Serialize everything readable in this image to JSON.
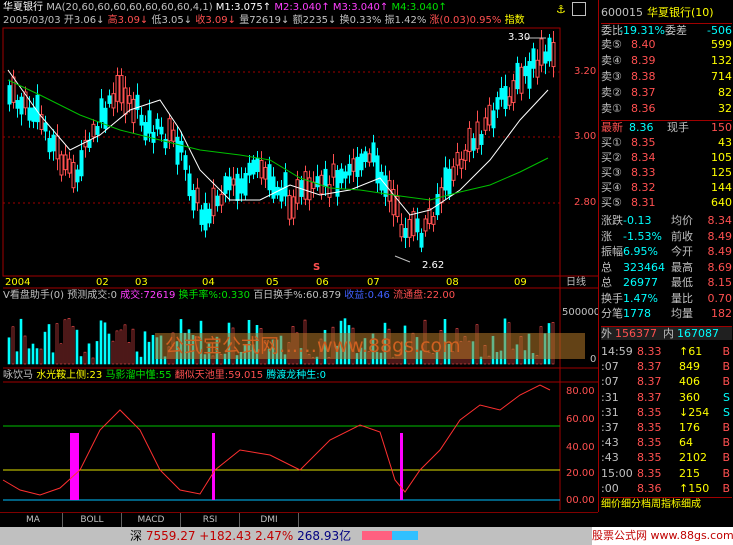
{
  "header": {
    "stock_name": "华夏银行",
    "ma_label": "MA(20,60,60,60,60,60,60,60,4,1)",
    "m1": "M1:3.075↑",
    "m2": "M2:3.040↑",
    "m3": "M3:3.040↑",
    "m4": "M4:3.040↑",
    "date": "2005/03/03",
    "open": "开3.06↓",
    "high": "高3.09↓",
    "low": "低3.05↓",
    "close": "收3.09↓",
    "volume": "量72619↓",
    "amount": "额2235↓",
    "turnover": "换0.33%",
    "amplitude": "振1.42%",
    "change": "涨(0.03)0.95%",
    "indicator": "指数"
  },
  "price_axis": [
    "3.20",
    "3.00",
    "2.80"
  ],
  "annotations": {
    "high_price": "3.30",
    "low_price": "2.62",
    "marker": "S"
  },
  "time_axis": [
    "2004",
    "02",
    "03",
    "04",
    "05",
    "06",
    "07",
    "08",
    "09"
  ],
  "period_label": "日线",
  "volume_panel": {
    "title": "V看盘助手(0)",
    "forecast": "预测成交:0",
    "deal": "成交:72619",
    "turnover_rate": "换手率%:0.330",
    "hundred_day": "百日换手%:60.879",
    "income": "收益:0.46",
    "float_shares": "流通盘:22.00",
    "axis": [
      "500000",
      "0"
    ]
  },
  "indicator_panel": {
    "name": "咏饮马",
    "s1": "水光鞍上侧:23",
    "s2": "马影溜中懂:55",
    "s3": "翻似天池里:59.015",
    "s4": "腾渡龙种生:0",
    "axis": [
      "80.00",
      "60.00",
      "40.00",
      "20.00",
      "00.00"
    ]
  },
  "watermark": "公式宝公式网……www.88gs.com",
  "tabs": [
    "MA",
    "BOLL",
    "MACD",
    "RSI",
    "DMI"
  ],
  "quote": {
    "code": "600015",
    "name": "华夏银行(10)",
    "weibi_label": "委比",
    "weibi": "-19.31%",
    "weicha_label": "委差",
    "weicha": "-506",
    "sells": [
      {
        "label": "卖⑤",
        "price": "8.40",
        "vol": "599"
      },
      {
        "label": "卖④",
        "price": "8.39",
        "vol": "132"
      },
      {
        "label": "卖③",
        "price": "8.38",
        "vol": "714"
      },
      {
        "label": "卖②",
        "price": "8.37",
        "vol": "82"
      },
      {
        "label": "卖①",
        "price": "8.36",
        "vol": "32"
      }
    ],
    "last_label": "最新",
    "last": "8.36",
    "now_label": "现手",
    "now": "150",
    "buys": [
      {
        "label": "买①",
        "price": "8.35",
        "vol": "43"
      },
      {
        "label": "买②",
        "price": "8.34",
        "vol": "105"
      },
      {
        "label": "买③",
        "price": "8.33",
        "vol": "125"
      },
      {
        "label": "买④",
        "price": "8.32",
        "vol": "144"
      },
      {
        "label": "买⑤",
        "price": "8.31",
        "vol": "640"
      }
    ],
    "stats": [
      {
        "l1": "涨跌",
        "v1": "-0.13",
        "l2": "均价",
        "v2": "8.34"
      },
      {
        "l1": "涨",
        "v1": "-1.53%",
        "l2": "前收",
        "v2": "8.49"
      },
      {
        "l1": "振幅",
        "v1": "6.95%",
        "l2": "今开",
        "v2": "8.49"
      },
      {
        "l1": "总",
        "v1": "323464",
        "l2": "最高",
        "v2": "8.69"
      },
      {
        "l1": "总",
        "v1": "26977",
        "l2": "最低",
        "v2": "8.15"
      },
      {
        "l1": "换手",
        "v1": "1.47%",
        "l2": "量比",
        "v2": "0.70"
      },
      {
        "l1": "分笔",
        "v1": "1778",
        "l2": "均量",
        "v2": "182"
      }
    ],
    "outer_label": "外",
    "outer": "156377",
    "inner_label": "内",
    "inner": "167087",
    "ticks": [
      {
        "t": "14:59",
        "p": "8.33",
        "v": "↑61",
        "s": "B"
      },
      {
        "t": ":07",
        "p": "8.37",
        "v": "849",
        "s": "B"
      },
      {
        "t": ":07",
        "p": "8.37",
        "v": "406",
        "s": "B"
      },
      {
        "t": ":31",
        "p": "8.37",
        "v": "360",
        "s": "S"
      },
      {
        "t": ":31",
        "p": "8.35",
        "v": "↓254",
        "s": "S"
      },
      {
        "t": ":37",
        "p": "8.35",
        "v": "176",
        "s": "B"
      },
      {
        "t": ":43",
        "p": "8.35",
        "v": "64",
        "s": "B"
      },
      {
        "t": ":43",
        "p": "8.35",
        "v": "2102",
        "s": "B"
      },
      {
        "t": "15:00",
        "p": "8.35",
        "v": "215",
        "s": "B"
      },
      {
        "t": ":00",
        "p": "8.36",
        "v": "↑150",
        "s": "B"
      }
    ],
    "footer": "细价细分档周指标细成"
  },
  "status_bar": {
    "index_name": "深",
    "index_value": "7559.27",
    "index_change": "+182.43",
    "index_pct": "2.47%",
    "index_amount": "268.93亿",
    "site": "股票公式网 www.88gs.com"
  },
  "colors": {
    "up": "#ff5050",
    "down": "#00ffff",
    "ma_white": "#ffffff",
    "ma_green": "#00c000",
    "grid_red": "#a00000"
  }
}
